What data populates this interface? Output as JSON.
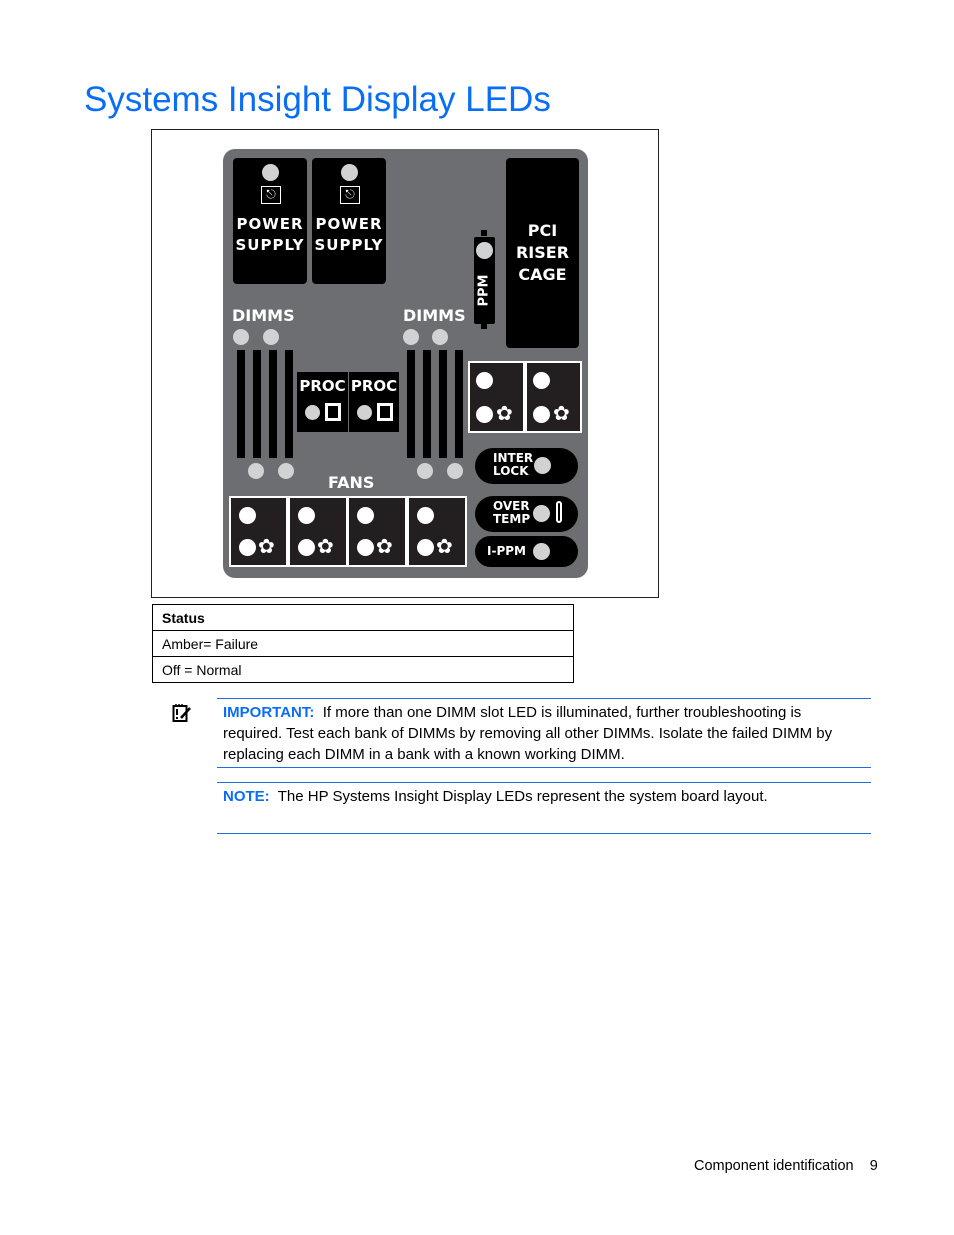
{
  "page_title": "Systems Insight Display LEDs",
  "diagram": {
    "power_supply_labels": [
      "POWER\nSUPPLY",
      "POWER\nSUPPLY"
    ],
    "pci_label": "PCI\nRISER\nCAGE",
    "ppm_label": "PPM",
    "dimms_left_label": "DIMMS",
    "dimms_right_label": "DIMMS",
    "proc_labels": [
      "PROC",
      "PROC"
    ],
    "fans_label": "FANS",
    "interlock_label": "INTER\nLOCK",
    "overtemp_label": "OVER\nTEMP",
    "ippm_label": "I-PPM",
    "led_colors": {
      "off": "#d1d2d4",
      "fan": "#ffffff"
    },
    "panel_color": "#6d6e71"
  },
  "status_table": {
    "header": "Status",
    "rows": [
      "Amber= Failure",
      "Off = Normal"
    ]
  },
  "important": {
    "label": "IMPORTANT:",
    "text": "If more than one DIMM slot LED is illuminated, further troubleshooting is required. Test each bank of DIMMs by removing all other DIMMs. Isolate the failed DIMM by replacing each DIMM in a bank with a known working DIMM."
  },
  "note": {
    "label": "NOTE:",
    "text": "The HP Systems Insight Display LEDs represent the system board layout."
  },
  "footer": {
    "section": "Component identification",
    "page_number": "9"
  }
}
